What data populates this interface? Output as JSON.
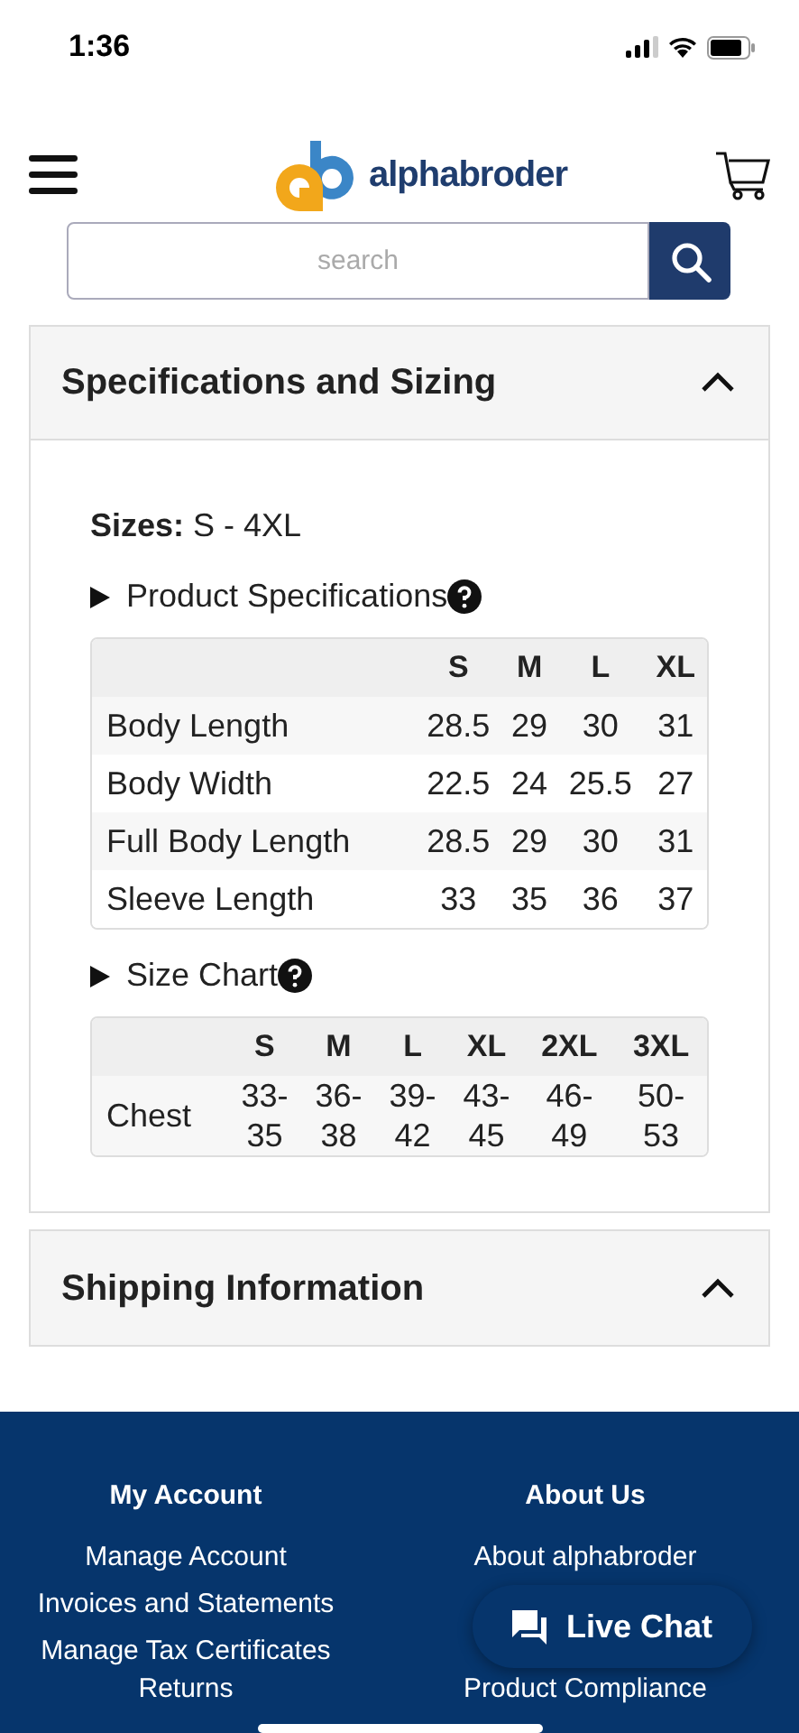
{
  "status_bar": {
    "time": "1:36"
  },
  "header": {
    "logo_text": "alphabroder"
  },
  "search": {
    "placeholder": "search"
  },
  "sections": [
    {
      "title": "Specifications and Sizing",
      "expanded": true,
      "sizes_label": "Sizes:",
      "sizes_value": "S - 4XL",
      "tables": [
        {
          "title": "Product Specifications",
          "columns": [
            "",
            "S",
            "M",
            "L",
            "XL"
          ],
          "rows": [
            [
              "Body Length",
              "28.5",
              "29",
              "30",
              "31"
            ],
            [
              "Body Width",
              "22.5",
              "24",
              "25.5",
              "27"
            ],
            [
              "Full Body Length",
              "28.5",
              "29",
              "30",
              "31"
            ],
            [
              "Sleeve Length",
              "33",
              "35",
              "36",
              "37"
            ]
          ]
        },
        {
          "title": "Size Chart",
          "columns": [
            "",
            "S",
            "M",
            "L",
            "XL",
            "2XL",
            "3XL"
          ],
          "rows": [
            [
              "Chest",
              "33-\n35",
              "36-\n38",
              "39-\n42",
              "43-\n45",
              "46-\n49",
              "50-\n53"
            ]
          ]
        }
      ]
    },
    {
      "title": "Shipping Information",
      "expanded": true
    }
  ],
  "footer": {
    "columns": [
      {
        "title": "My Account",
        "links": [
          "Manage Account",
          "Invoices and Statements",
          "Manage Tax Certificates",
          "Returns"
        ]
      },
      {
        "title": "About Us",
        "links": [
          "About alphabroder",
          "Product Compliance"
        ]
      }
    ]
  },
  "live_chat": {
    "label": "Live Chat"
  }
}
